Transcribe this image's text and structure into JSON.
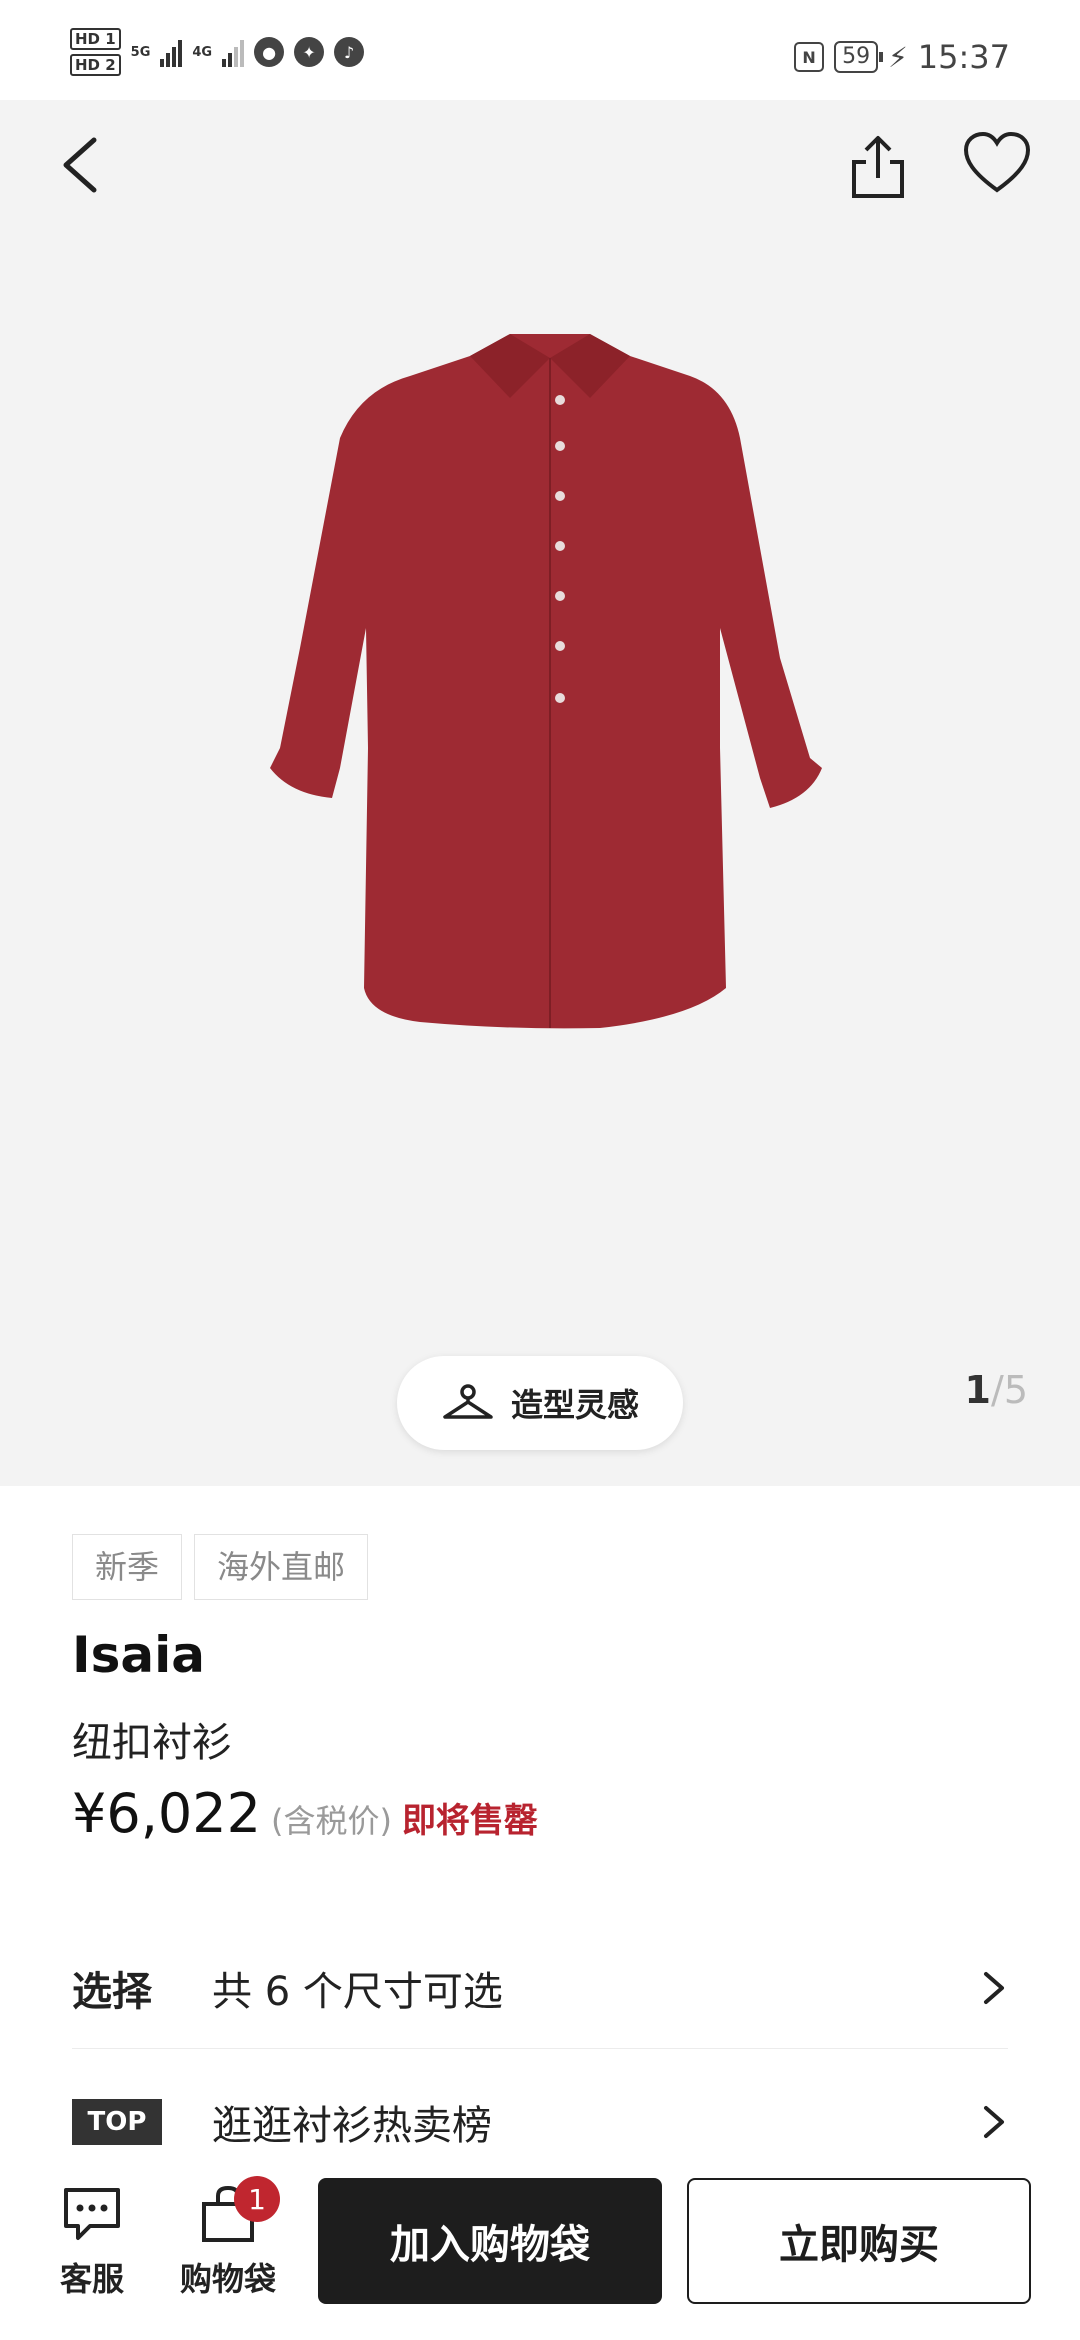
{
  "status_bar": {
    "hd1": "HD 1",
    "hd2": "HD 2",
    "net1": "5G",
    "net2": "4G",
    "battery": "59",
    "time": "15:37",
    "nfc": "N"
  },
  "gallery": {
    "style_label": "造型灵感",
    "page_current": "1",
    "page_sep": "/",
    "page_total": "5",
    "shirt_color": "#9e2a33"
  },
  "product": {
    "tags": [
      "新季",
      "海外直邮"
    ],
    "brand": "Isaia",
    "name": "纽扣衬衫",
    "price": "¥6,022",
    "tax_note": "(含税价)",
    "stock_note": "即将售罄"
  },
  "rows": {
    "size_label": "选择",
    "size_text": "共 6 个尺寸可选",
    "top_badge": "TOP",
    "top_text": "逛逛衬衫热卖榜"
  },
  "bottom_bar": {
    "service_label": "客服",
    "bag_label": "购物袋",
    "bag_count": "1",
    "add_label": "加入购物袋",
    "buy_label": "立即购买"
  }
}
